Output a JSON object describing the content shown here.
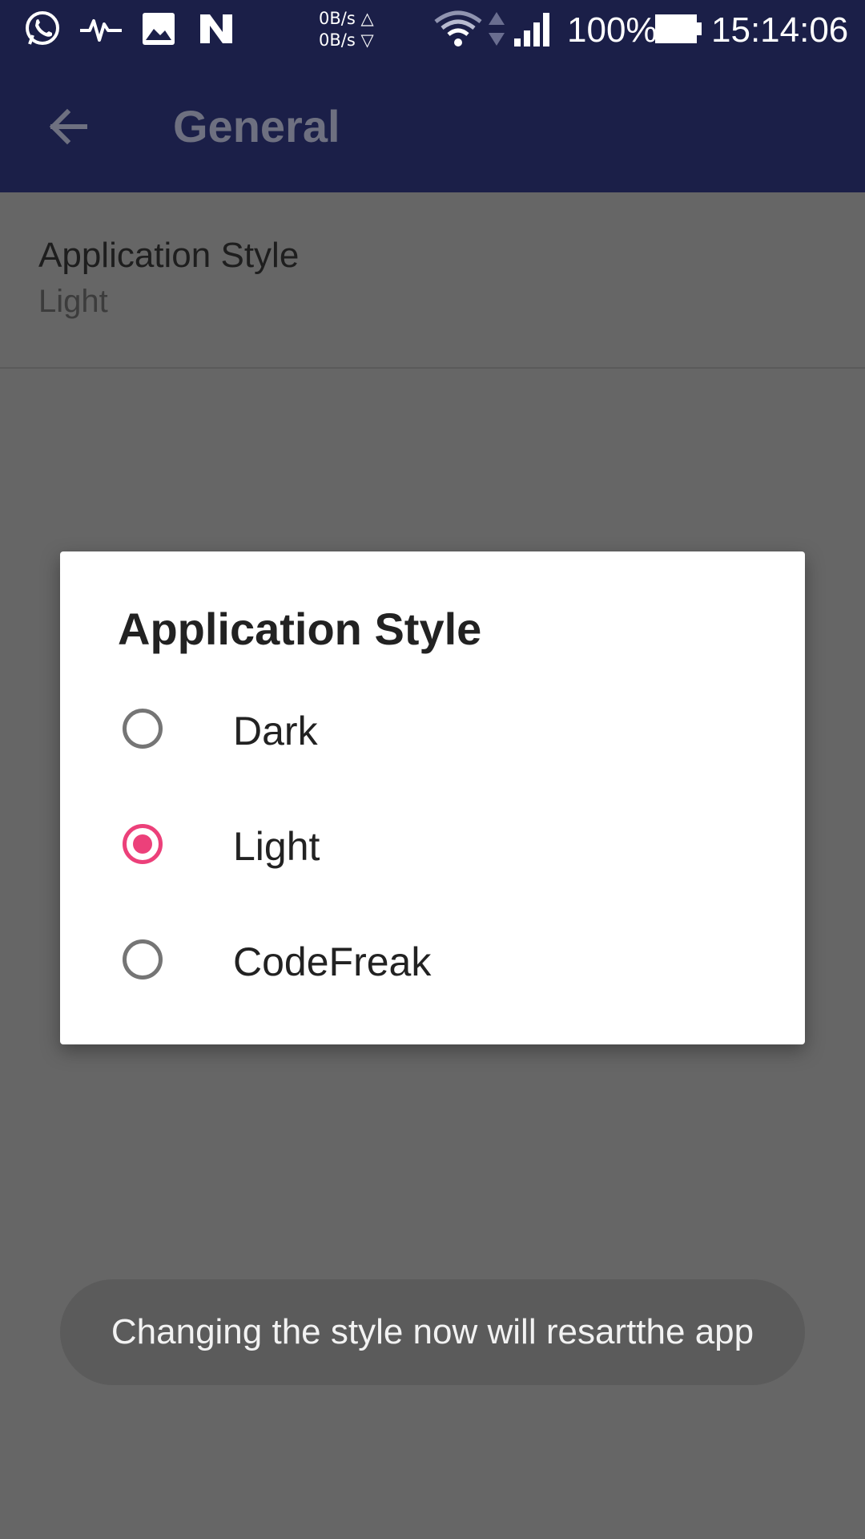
{
  "status_bar": {
    "icons": [
      "whatsapp-icon",
      "activity-icon",
      "gallery-icon",
      "n-app-icon",
      "wifi-icon",
      "data-arrows-icon",
      "signal-icon",
      "battery-icon"
    ],
    "speed_up": "0B/s △",
    "speed_down": "0B/s ▽",
    "battery_percent": "100%",
    "time": "15:14:06"
  },
  "app_bar": {
    "title": "General",
    "back_icon": "arrow-back-icon",
    "color": "#1b1f48"
  },
  "preference": {
    "title": "Application Style",
    "summary": "Light"
  },
  "dialog": {
    "title": "Application Style",
    "options": [
      {
        "label": "Dark",
        "checked": false
      },
      {
        "label": "Light",
        "checked": true
      },
      {
        "label": "CodeFreak",
        "checked": false
      }
    ],
    "accent": "#ec407a"
  },
  "toast": {
    "message": "Changing the style now will resartthe app"
  }
}
